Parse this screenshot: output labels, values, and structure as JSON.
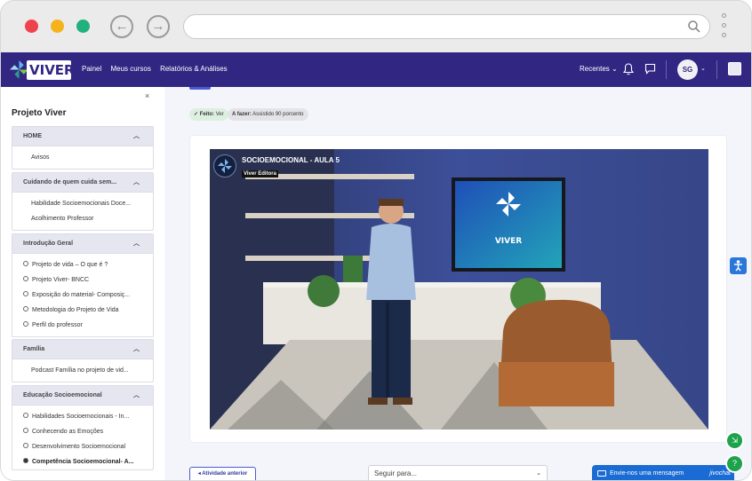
{
  "browser": {
    "url": ""
  },
  "navbar": {
    "logo_text": "VIVER",
    "menu": [
      "Painel",
      "Meus cursos",
      "Relatórios & Análises"
    ],
    "recentes_label": "Recentes",
    "user_initials": "SG"
  },
  "sidebar": {
    "close_label": "×",
    "title": "Projeto Viver",
    "sections": [
      {
        "header": "HOME",
        "items": [
          {
            "label": "Avisos",
            "type": "plain"
          }
        ]
      },
      {
        "header": "Cuidando de quem cuida sem...",
        "items": [
          {
            "label": "Habilidade Socioemocionais Doce...",
            "type": "plain"
          },
          {
            "label": "Acolhimento Professor",
            "type": "plain"
          }
        ]
      },
      {
        "header": "Introdução Geral",
        "items": [
          {
            "label": "Projeto de vida – O que é ?",
            "type": "bullet"
          },
          {
            "label": "Projeto Viver- BNCC",
            "type": "bullet"
          },
          {
            "label": "Exposição do material- Composiç...",
            "type": "bullet"
          },
          {
            "label": "Metodologia do Projeto de Vida",
            "type": "bullet"
          },
          {
            "label": "Perfil do professor",
            "type": "bullet"
          }
        ]
      },
      {
        "header": "Família",
        "items": [
          {
            "label": "Podcast Família no projeto de vid...",
            "type": "plain"
          }
        ]
      },
      {
        "header": "Educação Socioemocional",
        "items": [
          {
            "label": "Habilidades Socioemocionais - In...",
            "type": "bullet"
          },
          {
            "label": "Conhecendo as Emoções",
            "type": "bullet"
          },
          {
            "label": "Desenvolvimento Socioemocional",
            "type": "bullet"
          },
          {
            "label": "Competência Socioemocional- A...",
            "type": "bullet",
            "active": true
          }
        ]
      }
    ]
  },
  "activity": {
    "done_prefix": "✓ Feito:",
    "done_value": "Ver",
    "todo_prefix": "A fazer:",
    "todo_value": "Assistido 90 porcento"
  },
  "video": {
    "title": "SOCIOEMOCIONAL - AULA 5",
    "channel": "Viver Editora",
    "tv_text": "VIVER"
  },
  "footer": {
    "prev_label": "◂  Atividade anterior",
    "select_placeholder": "Seguir para...",
    "chat_label": "Envie-nos uma mensagem",
    "chat_brand": "jivochat"
  },
  "colors": {
    "navbar": "#312783",
    "accent": "#4a5ad2",
    "chat": "#1b6bd4",
    "fab": "#1ea24b"
  }
}
